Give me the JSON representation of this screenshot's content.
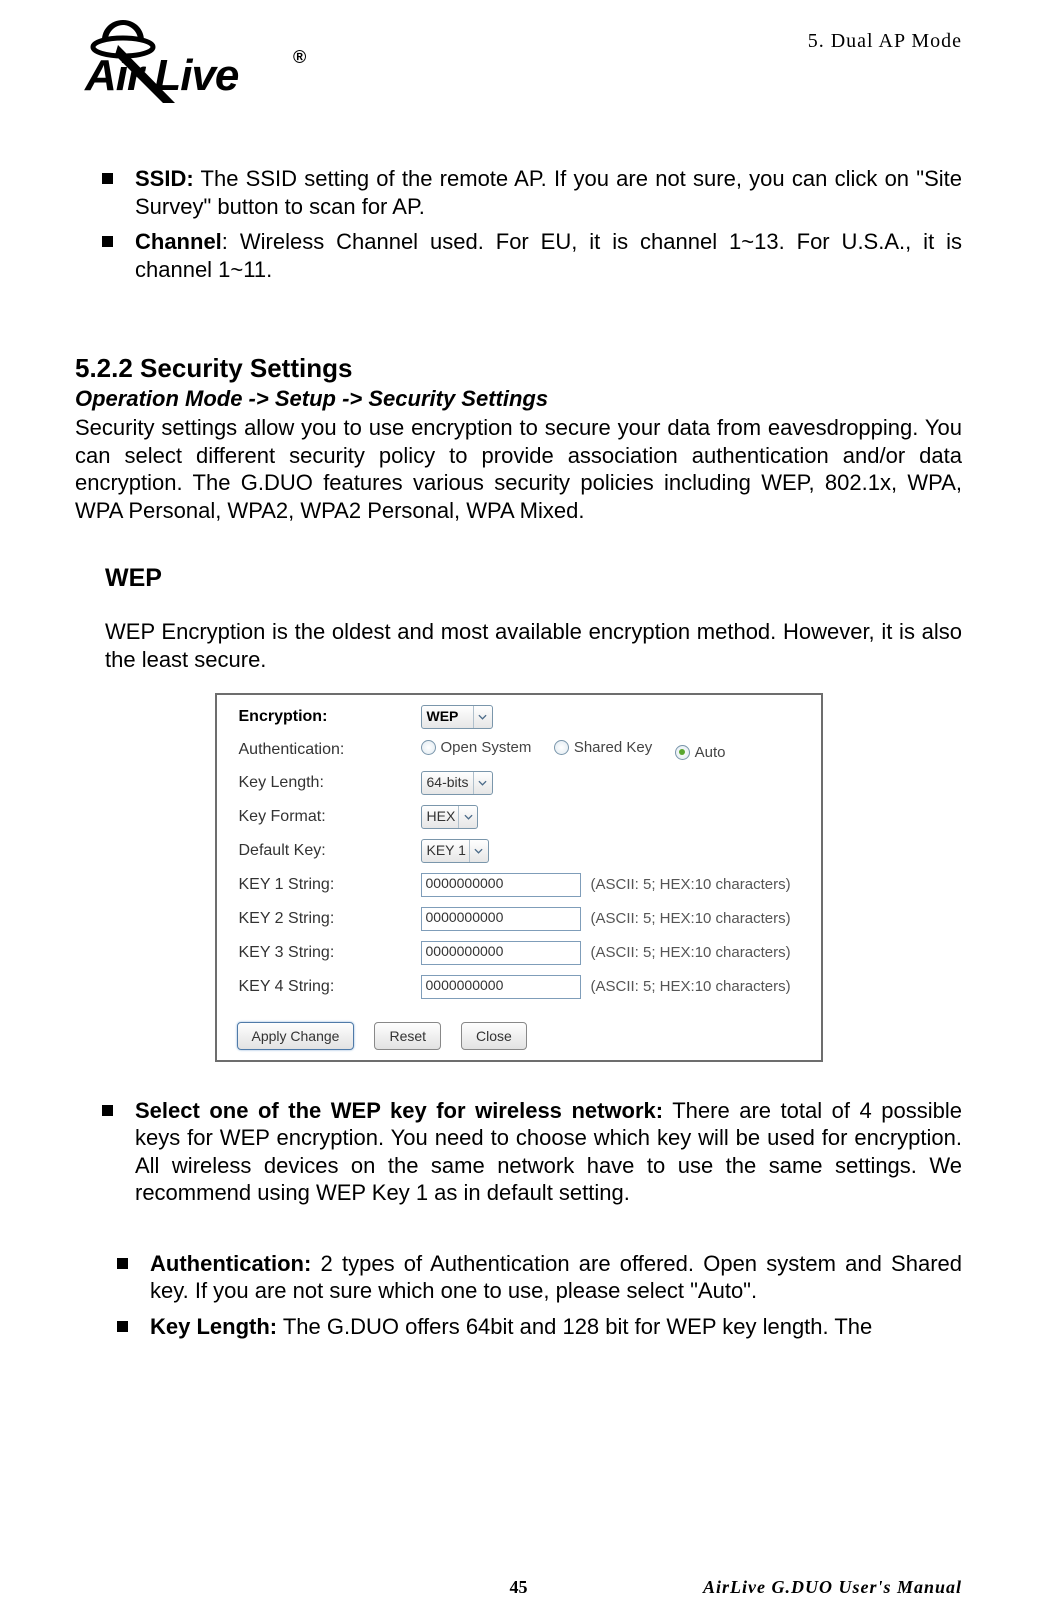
{
  "header": {
    "chapter": "5.  Dual AP Mode",
    "logo_text": "AirLive"
  },
  "bullets1": [
    {
      "label": "SSID:",
      "text": "  The SSID setting of the remote AP.  If you are not sure, you can click on \"Site Survey\" button to scan for AP."
    },
    {
      "label": "Channel",
      "post": ":",
      "text": "  Wireless Channel used.  For EU, it is channel 1~13.  For U.S.A., it is channel 1~11."
    }
  ],
  "section": {
    "heading": "5.2.2 Security Settings",
    "navpath": "Operation Mode -> Setup -> Security Settings",
    "para": "Security settings allow you to use encryption to secure your data from eavesdropping. You can select different security policy to provide association authentication and/or data encryption.  The G.DUO features various security policies including WEP, 802.1x, WPA, WPA Personal, WPA2, WPA2 Personal, WPA Mixed."
  },
  "wep": {
    "heading": "WEP",
    "para": "WEP Encryption is the oldest and most available encryption method.  However, it is also the least secure."
  },
  "panel": {
    "encryption_label": "Encryption:",
    "encryption_value": "WEP",
    "auth_label": "Authentication:",
    "auth_options": [
      "Open System",
      "Shared Key",
      "Auto"
    ],
    "auth_selected_index": 2,
    "keylen_label": "Key Length:",
    "keylen_value": "64-bits",
    "keyfmt_label": "Key Format:",
    "keyfmt_value": "HEX",
    "defkey_label": "Default Key:",
    "defkey_value": "KEY 1",
    "keys": [
      {
        "label": "KEY 1 String:",
        "value": "0000000000",
        "hint": "(ASCII: 5; HEX:10 characters)"
      },
      {
        "label": "KEY 2 String:",
        "value": "0000000000",
        "hint": "(ASCII: 5; HEX:10 characters)"
      },
      {
        "label": "KEY 3 String:",
        "value": "0000000000",
        "hint": "(ASCII: 5; HEX:10 characters)"
      },
      {
        "label": "KEY 4 String:",
        "value": "0000000000",
        "hint": "(ASCII: 5; HEX:10 characters)"
      }
    ],
    "buttons": {
      "apply": "Apply Change",
      "reset": "Reset",
      "close": "Close"
    }
  },
  "bullets2": [
    {
      "label": "Select one of the WEP key for wireless network:",
      "text": "  There are total of 4 possible keys for WEP encryption.  You need to choose which key will be used for encryption.  All wireless devices on the same network have to use the same settings.  We recommend using WEP Key 1 as in default setting."
    }
  ],
  "bullets3": [
    {
      "label": "Authentication:",
      "text": "  2 types of Authentication are offered.  Open system and Shared key.  If you are not sure which one to use, please select \"Auto\"."
    },
    {
      "label": "Key Length:",
      "text": "  The G.DUO offers 64bit and 128 bit for WEP key length.  The"
    }
  ],
  "footer": {
    "page": "45",
    "manual": "AirLive G.DUO User's Manual"
  }
}
